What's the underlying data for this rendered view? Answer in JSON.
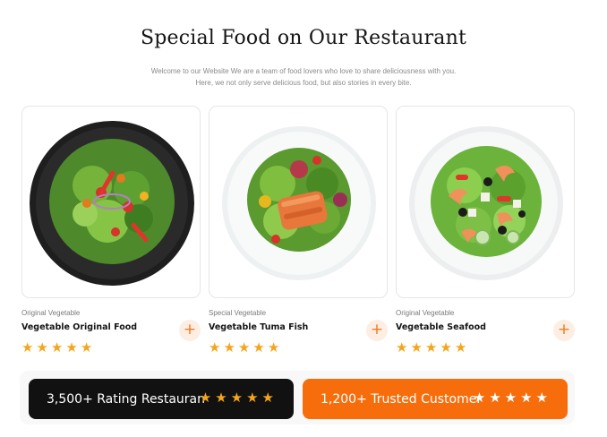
{
  "header": {
    "title": "Special Food on Our Restaurant",
    "subtitle_line1": "Welcome to our Website We are a team of food lovers who love to share deliciousness with you.",
    "subtitle_line2": "Here, we not only serve delicious food, but also stories in every bite."
  },
  "cards": [
    {
      "category": "Original Vegetable",
      "name": "Vegetable Original Food",
      "rating": 5,
      "add_icon": "plus-icon"
    },
    {
      "category": "Special Vegetable",
      "name": "Vegetable Tuma Fish",
      "rating": 5,
      "add_icon": "plus-icon"
    },
    {
      "category": "Original Vegetable",
      "name": "Vegetable Seafood",
      "rating": 5,
      "add_icon": "plus-icon"
    }
  ],
  "stats": [
    {
      "label": "3,500+ Rating Restauran",
      "rating": 5
    },
    {
      "label": "1,200+ Trusted Customer",
      "rating": 5
    }
  ],
  "colors": {
    "accent": "#f76d0c",
    "star": "#f4a51c",
    "dark": "#111111"
  }
}
